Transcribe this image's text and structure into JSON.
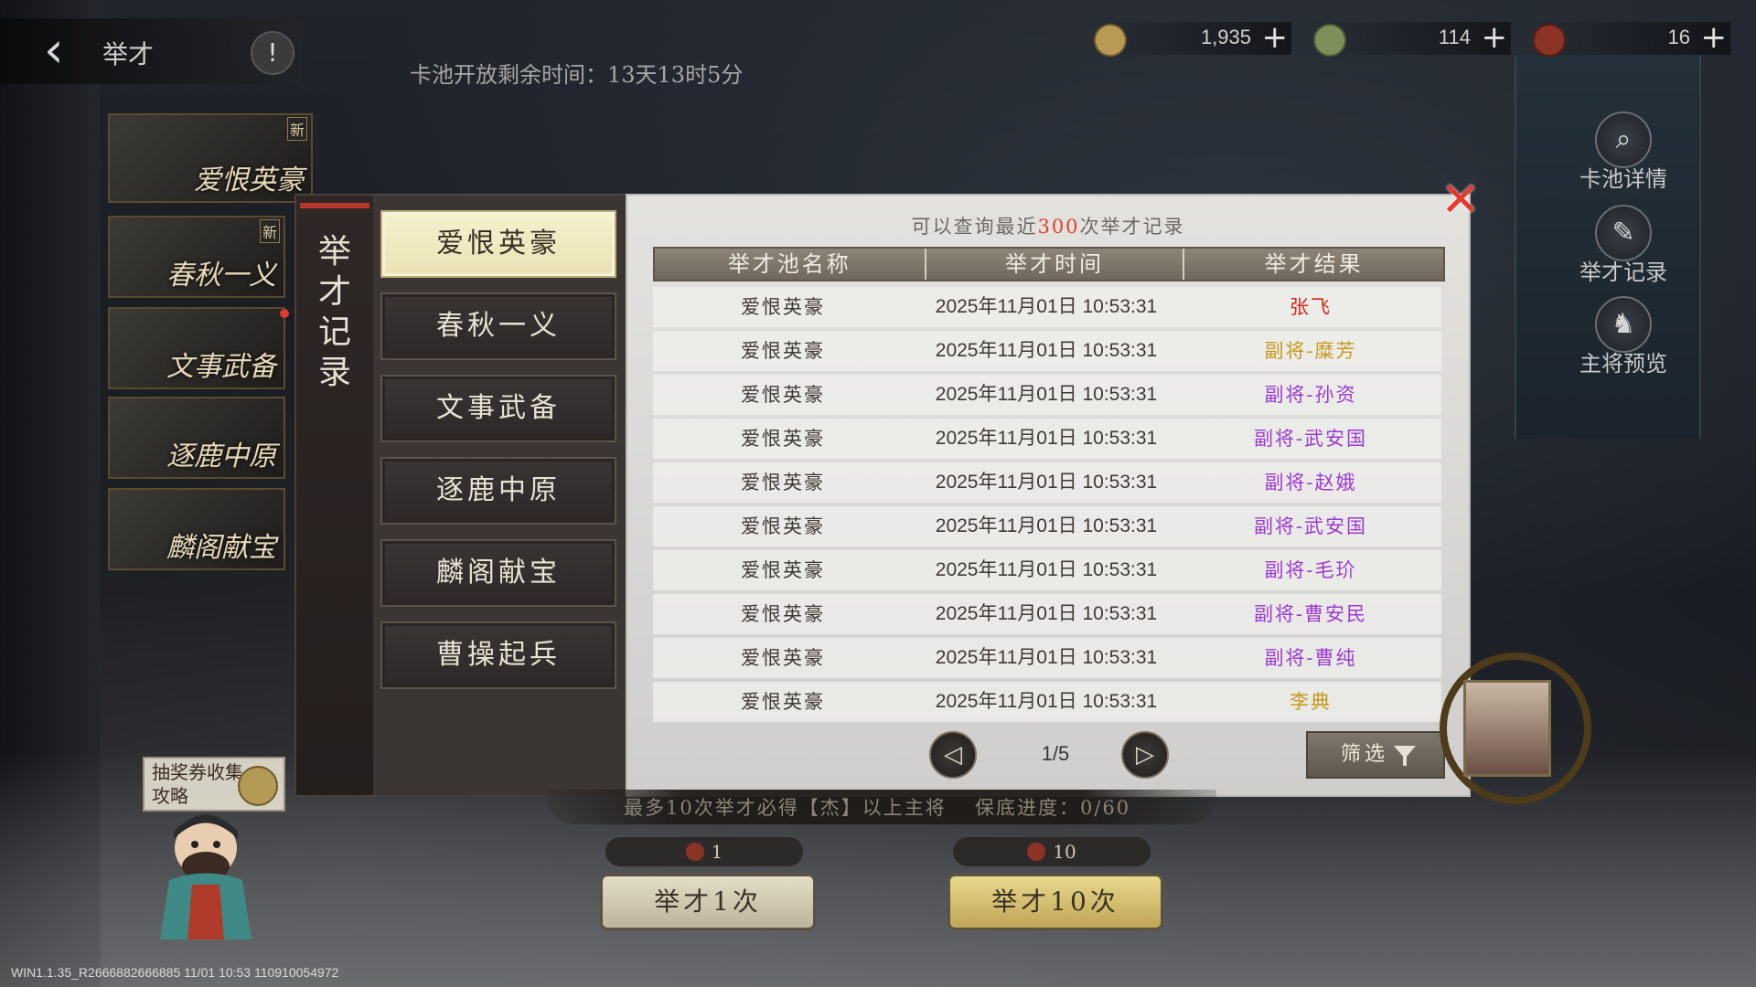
{
  "header": {
    "title": "举才",
    "info_label": "!",
    "pool_timer": "卡池开放剩余时间：13天13时5分"
  },
  "currencies": [
    {
      "value": "1,935",
      "icon": "coin-icon",
      "color": "#b89a55"
    },
    {
      "value": "114",
      "icon": "jade-coin-icon",
      "color": "#7f8f5a"
    },
    {
      "value": "16",
      "icon": "red-token-icon",
      "color": "#8b3324"
    }
  ],
  "side_buttons": [
    {
      "label": "卡池详情",
      "icon": "magnifier-icon"
    },
    {
      "label": "举才记录",
      "icon": "brush-icon"
    },
    {
      "label": "主将预览",
      "icon": "helmet-icon"
    }
  ],
  "banners": [
    {
      "title": "爱恨英豪",
      "badge": "新"
    },
    {
      "title": "春秋一义",
      "badge": "新"
    },
    {
      "title": "文事武备",
      "badge": ""
    },
    {
      "title": "逐鹿中原",
      "badge": ""
    },
    {
      "title": "麟阁献宝",
      "badge": ""
    }
  ],
  "guide": {
    "text": "抽奖券收集攻略"
  },
  "modal": {
    "vertical_title": "举才记录",
    "nav": [
      "爱恨英豪",
      "春秋一义",
      "文事武备",
      "逐鹿中原",
      "麟阁献宝",
      "曹操起兵"
    ],
    "active_nav": 0,
    "hint_prefix": "可以查询最近",
    "hint_count": "300",
    "hint_suffix": "次举才记录",
    "columns": [
      "举才池名称",
      "举才时间",
      "举才结果"
    ],
    "rows": [
      {
        "pool": "爱恨英豪",
        "time": "2025年11月01日 10:53:31",
        "result": "张飞",
        "color": "#d0281c"
      },
      {
        "pool": "爱恨英豪",
        "time": "2025年11月01日 10:53:31",
        "result": "副将-糜芳",
        "color": "#c79a1c"
      },
      {
        "pool": "爱恨英豪",
        "time": "2025年11月01日 10:53:31",
        "result": "副将-孙资",
        "color": "#9b3bd0"
      },
      {
        "pool": "爱恨英豪",
        "time": "2025年11月01日 10:53:31",
        "result": "副将-武安国",
        "color": "#9b3bd0"
      },
      {
        "pool": "爱恨英豪",
        "time": "2025年11月01日 10:53:31",
        "result": "副将-赵娥",
        "color": "#9b3bd0"
      },
      {
        "pool": "爱恨英豪",
        "time": "2025年11月01日 10:53:31",
        "result": "副将-武安国",
        "color": "#9b3bd0"
      },
      {
        "pool": "爱恨英豪",
        "time": "2025年11月01日 10:53:31",
        "result": "副将-毛玠",
        "color": "#9b3bd0"
      },
      {
        "pool": "爱恨英豪",
        "time": "2025年11月01日 10:53:31",
        "result": "副将-曹安民",
        "color": "#9b3bd0"
      },
      {
        "pool": "爱恨英豪",
        "time": "2025年11月01日 10:53:31",
        "result": "副将-曹纯",
        "color": "#9b3bd0"
      },
      {
        "pool": "爱恨英豪",
        "time": "2025年11月01日 10:53:31",
        "result": "李典",
        "color": "#c79a1c"
      }
    ],
    "page": "1/5",
    "filter_label": "筛选",
    "close_label": "✕"
  },
  "draw": {
    "pity_text": "最多10次举才必得【杰】以上主将",
    "pity_progress": "保底进度：0/60",
    "single_cost": "1",
    "single_label": "举才1次",
    "ten_cost": "10",
    "ten_label": "举才10次"
  },
  "version": "WIN1.1.35_R2666882666885 11/01 10:53 110910054972"
}
